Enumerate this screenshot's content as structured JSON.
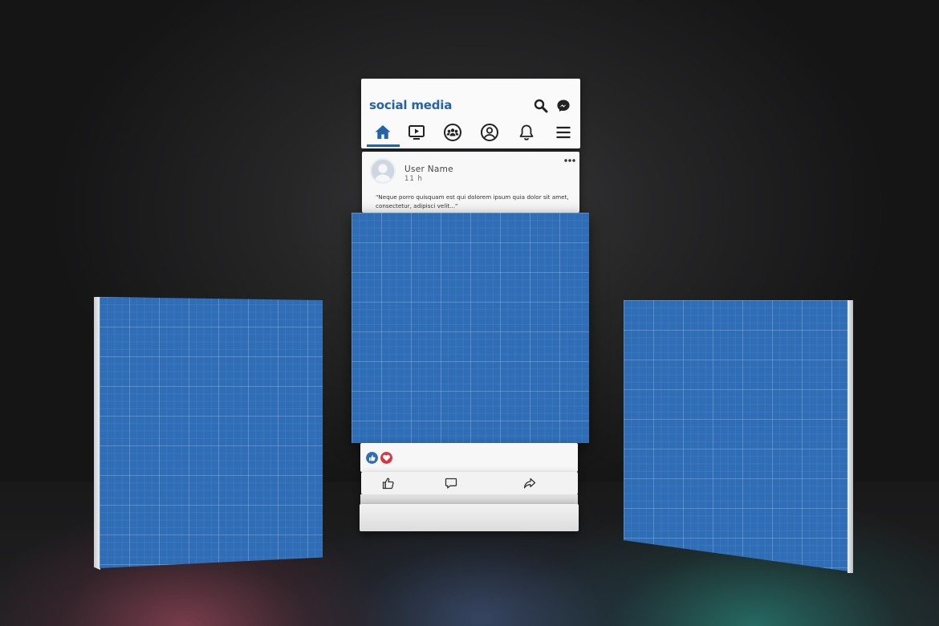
{
  "header": {
    "brand": "social media",
    "icons": [
      "search-icon",
      "messenger-icon"
    ],
    "nav": [
      "home-icon",
      "video-icon",
      "groups-icon",
      "profile-icon",
      "bell-icon",
      "menu-icon"
    ],
    "active_nav": "home-icon"
  },
  "post": {
    "user_name": "User Name",
    "time": "11 h",
    "text": "\"Neque porro quisquam est qui dolorem ipsum quia dolor sit amet, consectetur, adipisci velit...\""
  },
  "reactions": [
    "like-icon",
    "love-icon"
  ],
  "actions": [
    "like-button",
    "comment-button",
    "share-button"
  ],
  "colors": {
    "brand_blue": "#2563a8",
    "panel_blue": "#2f6db6",
    "love_red": "#e0323c",
    "background": "#1b1b1c"
  }
}
